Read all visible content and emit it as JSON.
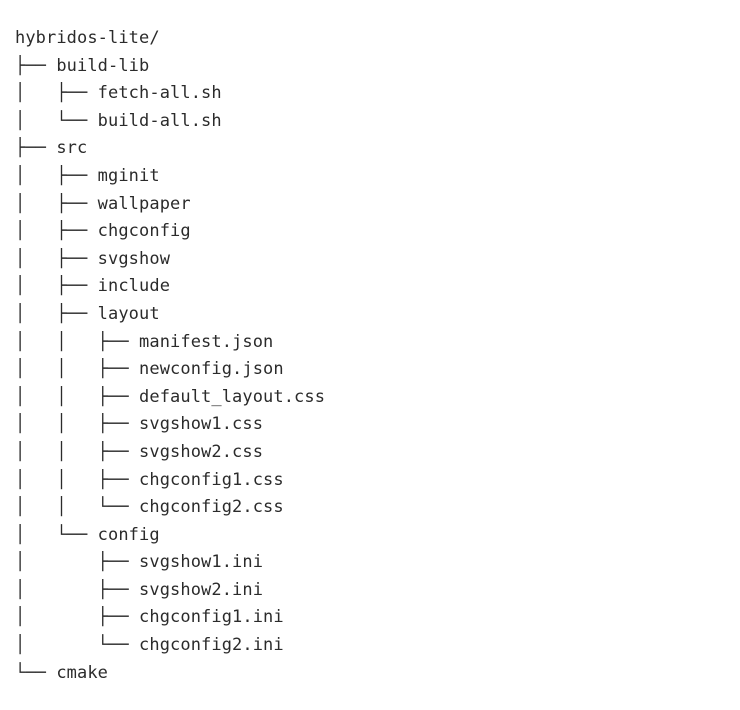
{
  "terminal": {
    "background_color": "#ffffff",
    "text_color": "#2b2b2b",
    "root_label": "hybridos-lite/",
    "tree_lines": [
      "hybridos-lite/",
      "├── build-lib",
      "│   ├── fetch-all.sh",
      "│   └── build-all.sh",
      "├── src",
      "│   ├── mginit",
      "│   ├── wallpaper",
      "│   ├── chgconfig",
      "│   ├── svgshow",
      "│   ├── include",
      "│   ├── layout",
      "│   │   ├── manifest.json",
      "│   │   ├── newconfig.json",
      "│   │   ├── default_layout.css",
      "│   │   ├── svgshow1.css",
      "│   │   ├── svgshow2.css",
      "│   │   ├── chgconfig1.css",
      "│   │   └── chgconfig2.css",
      "│   └── config",
      "│       ├── svgshow1.ini",
      "│       ├── svgshow2.ini",
      "│       ├── chgconfig1.ini",
      "│       └── chgconfig2.ini",
      "└── cmake"
    ],
    "entries": [
      {
        "name": "hybridos-lite/",
        "depth": 0,
        "type": "directory",
        "connector": ""
      },
      {
        "name": "build-lib",
        "depth": 1,
        "type": "directory",
        "connector": "branch"
      },
      {
        "name": "fetch-all.sh",
        "depth": 2,
        "type": "file",
        "connector": "branch"
      },
      {
        "name": "build-all.sh",
        "depth": 2,
        "type": "file",
        "connector": "last"
      },
      {
        "name": "src",
        "depth": 1,
        "type": "directory",
        "connector": "branch"
      },
      {
        "name": "mginit",
        "depth": 2,
        "type": "directory",
        "connector": "branch"
      },
      {
        "name": "wallpaper",
        "depth": 2,
        "type": "directory",
        "connector": "branch"
      },
      {
        "name": "chgconfig",
        "depth": 2,
        "type": "directory",
        "connector": "branch"
      },
      {
        "name": "svgshow",
        "depth": 2,
        "type": "directory",
        "connector": "branch"
      },
      {
        "name": "include",
        "depth": 2,
        "type": "directory",
        "connector": "branch"
      },
      {
        "name": "layout",
        "depth": 2,
        "type": "directory",
        "connector": "branch"
      },
      {
        "name": "manifest.json",
        "depth": 3,
        "type": "file",
        "connector": "branch"
      },
      {
        "name": "newconfig.json",
        "depth": 3,
        "type": "file",
        "connector": "branch"
      },
      {
        "name": "default_layout.css",
        "depth": 3,
        "type": "file",
        "connector": "branch"
      },
      {
        "name": "svgshow1.css",
        "depth": 3,
        "type": "file",
        "connector": "branch"
      },
      {
        "name": "svgshow2.css",
        "depth": 3,
        "type": "file",
        "connector": "branch"
      },
      {
        "name": "chgconfig1.css",
        "depth": 3,
        "type": "file",
        "connector": "branch"
      },
      {
        "name": "chgconfig2.css",
        "depth": 3,
        "type": "file",
        "connector": "last"
      },
      {
        "name": "config",
        "depth": 2,
        "type": "directory",
        "connector": "last"
      },
      {
        "name": "svgshow1.ini",
        "depth": 3,
        "type": "file",
        "connector": "branch"
      },
      {
        "name": "svgshow2.ini",
        "depth": 3,
        "type": "file",
        "connector": "branch"
      },
      {
        "name": "chgconfig1.ini",
        "depth": 3,
        "type": "file",
        "connector": "branch"
      },
      {
        "name": "chgconfig2.ini",
        "depth": 3,
        "type": "file",
        "connector": "last"
      },
      {
        "name": "cmake",
        "depth": 1,
        "type": "directory",
        "connector": "last"
      }
    ]
  }
}
